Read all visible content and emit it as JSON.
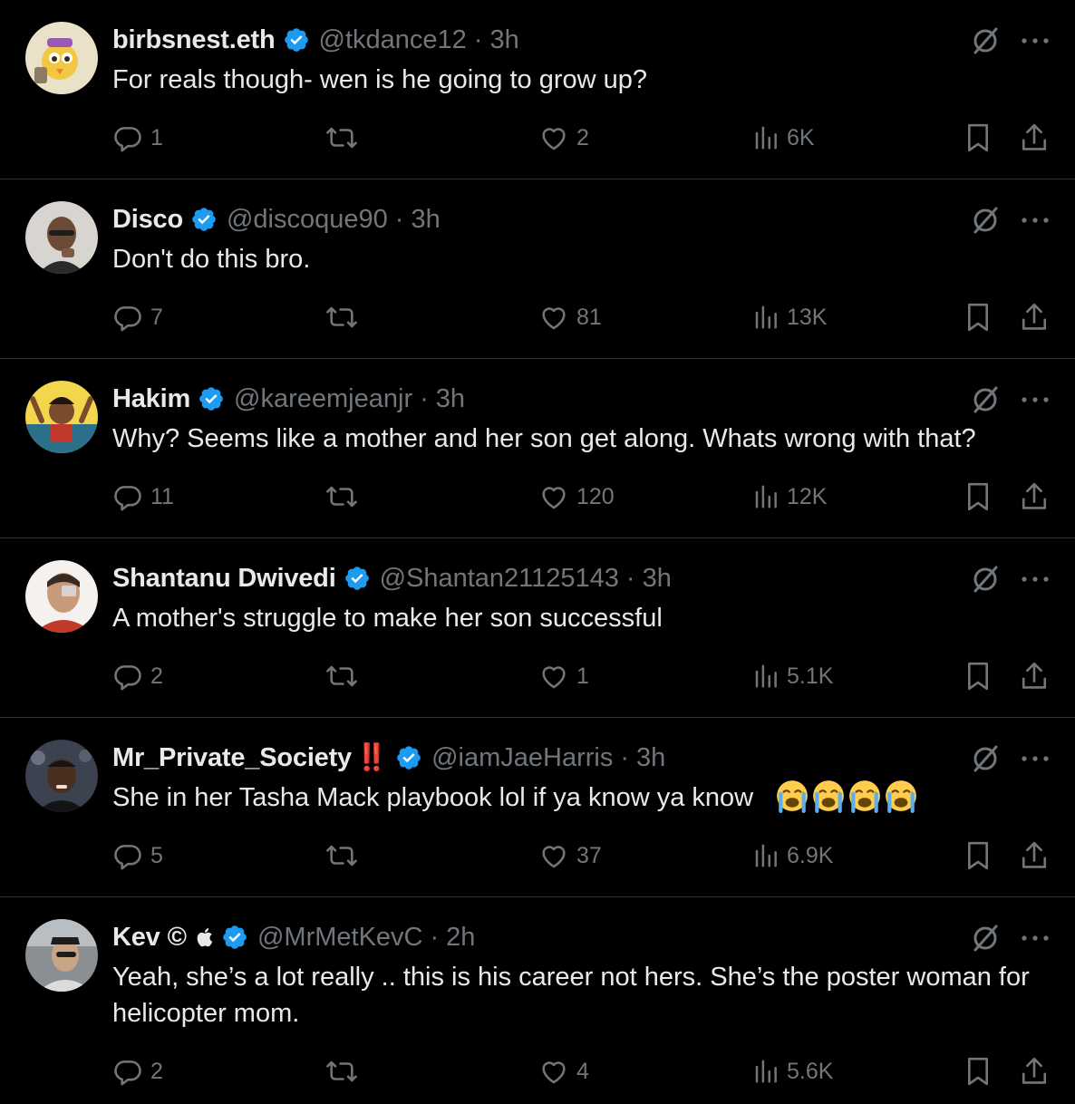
{
  "colors": {
    "background": "#000000",
    "text_primary": "#e7e9ea",
    "text_secondary": "#71767b",
    "divider": "#2f3336",
    "verified": "#1d9bf0",
    "accent_red": "#e0245e"
  },
  "icons": {
    "verified": "verified-badge-icon",
    "grok": "grok-icon",
    "more": "more-dots-icon",
    "reply": "reply-icon",
    "retweet": "retweet-icon",
    "like": "heart-icon",
    "views": "views-icon",
    "bookmark": "bookmark-icon",
    "share": "share-icon"
  },
  "tweets": [
    {
      "name": "birbsnest.eth",
      "handle": "@tkdance12",
      "sep": "·",
      "time": "3h",
      "text": "For reals though- wen is he going to grow up?",
      "replies": "1",
      "retweets": "",
      "likes": "2",
      "views": "6K"
    },
    {
      "name": "Disco",
      "handle": "@discoque90",
      "sep": "·",
      "time": "3h",
      "text": "Don't do this bro.",
      "replies": "7",
      "retweets": "",
      "likes": "81",
      "views": "13K"
    },
    {
      "name": "Hakim",
      "handle": "@kareemjeanjr",
      "sep": "·",
      "time": "3h",
      "text": "Why? Seems like a mother and her son get along. Whats wrong with that?",
      "replies": "11",
      "retweets": "",
      "likes": "120",
      "views": "12K"
    },
    {
      "name": "Shantanu Dwivedi",
      "handle": "@Shantan21125143",
      "sep": "·",
      "time": "3h",
      "text": "A mother's struggle to make her son successful",
      "replies": "2",
      "retweets": "",
      "likes": "1",
      "views": "5.1K"
    },
    {
      "name": "Mr_Private_Society",
      "name_suffix": "‼️",
      "handle": "@iamJaeHarris",
      "sep": "·",
      "time": "3h",
      "text": "She in her Tasha Mack playbook lol if ya know ya know",
      "emoji_name": "loudly-crying-face-emoji",
      "emoji_count": 4,
      "replies": "5",
      "retweets": "",
      "likes": "37",
      "views": "6.9K"
    },
    {
      "name": "Kev",
      "name_extras": "©",
      "name_apple": "",
      "handle": "@MrMetKevC",
      "sep": "·",
      "time": "2h",
      "text": "Yeah, she’s a lot really .. this is his career not hers. She’s the poster woman for helicopter mom.",
      "replies": "2",
      "retweets": "",
      "likes": "4",
      "views": "5.6K"
    }
  ]
}
